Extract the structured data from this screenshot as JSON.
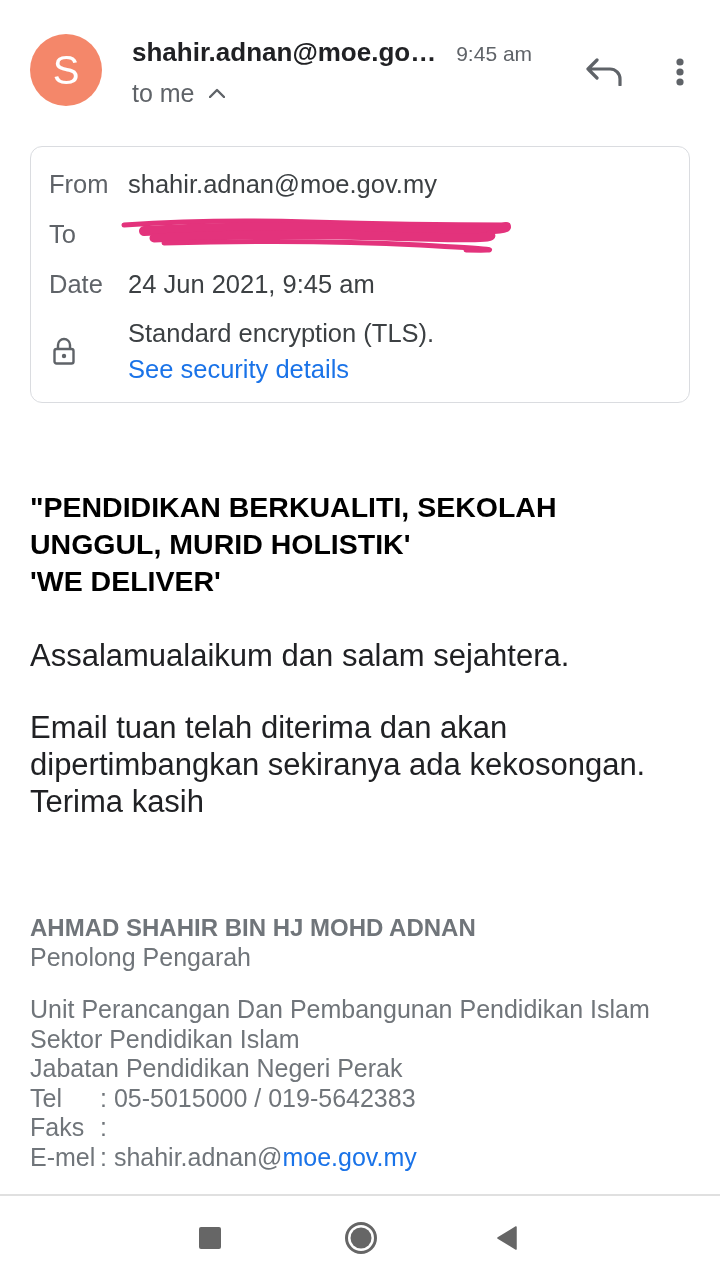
{
  "header": {
    "avatar_letter": "S",
    "sender": "shahir.adnan@moe.go…",
    "time": "9:45 am",
    "recipient_summary": "to me",
    "details_expanded": true
  },
  "details": {
    "rows": [
      {
        "kind": "text",
        "label": "From",
        "value": "shahir.adnan@moe.gov.my"
      },
      {
        "kind": "redacted",
        "label": "To"
      },
      {
        "kind": "text",
        "label": "Date",
        "value": "24 Jun 2021, 9:45 am"
      }
    ],
    "security": {
      "text": "Standard encryption (TLS).",
      "link": "See security details"
    }
  },
  "body": {
    "heading": [
      "\"PENDIDIKAN BERKUALITI, SEKOLAH UNGGUL, MURID HOLISTIK'",
      "'WE DELIVER'"
    ],
    "paragraphs": [
      "Assalamualaikum dan salam sejahtera.",
      "Email tuan telah diterima dan akan dipertimbangkan sekiranya ada kekosongan.\nTerima kasih"
    ]
  },
  "signature": {
    "name": "AHMAD SHAHIR BIN HJ MOHD ADNAN",
    "title": "Penolong Pengarah",
    "organisation": [
      "Unit Perancangan Dan Pembangunan Pendidikan Islam",
      "Sektor Pendidikan Islam",
      "Jabatan Pendidikan Negeri Perak"
    ],
    "contacts": [
      {
        "label": "Tel",
        "value": ": 05-5015000 / 019-5642383"
      },
      {
        "label": "Faks",
        "value": ":"
      },
      {
        "label": "E-mel",
        "value": ": shahir.adnan@",
        "link": "moe.gov.my"
      }
    ]
  },
  "nav_bar": {
    "buttons": [
      {
        "kind": "recents"
      },
      {
        "kind": "home"
      },
      {
        "kind": "back"
      }
    ]
  }
}
